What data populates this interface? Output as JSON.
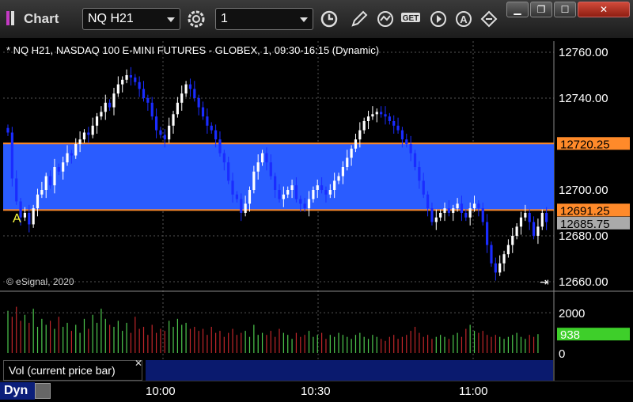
{
  "window": {
    "title": "Chart"
  },
  "toolbar": {
    "symbol": "NQ H21",
    "interval": "1",
    "icons": [
      "settings-gear-icon",
      "clock-icon",
      "pencil-icon",
      "study-icon",
      "get-icon",
      "play-icon",
      "alert-icon",
      "link-icon"
    ],
    "window_controls": [
      "minimize-icon",
      "restore-icon",
      "maximize-icon",
      "close-icon"
    ]
  },
  "colors": {
    "band": "#2a5cff",
    "band_border": "#ff8a2a",
    "up": "#ffffff",
    "down": "#1a2cff",
    "vol_up": "#4ec94e",
    "vol_down": "#c0262a",
    "vol_badge": "#3ecf2a"
  },
  "chart_data": {
    "type": "candlestick",
    "title": "* NQ H21, NASDAQ 100 E-MINI FUTURES - GLOBEX, 1, 09:30-16:15 (Dynamic)",
    "copyright": "© eSignal, 2020",
    "ylim": [
      12655,
      12765
    ],
    "y_ticks": [
      "12760.00",
      "12740.00",
      "12720.00",
      "12700.00",
      "12680.00",
      "12660.00"
    ],
    "x_ticks": [
      "10:00",
      "10:30",
      "11:00"
    ],
    "band": {
      "top": 12720.25,
      "bottom": 12691.25
    },
    "price_labels": {
      "band_top": "12720.25",
      "band_bottom": "12691.25",
      "last": "12685.75"
    },
    "marker": "A",
    "candles_close": [
      12725,
      12705,
      12695,
      12688,
      12690,
      12685,
      12692,
      12698,
      12700,
      12706,
      12702,
      12710,
      12708,
      12712,
      12716,
      12715,
      12720,
      12722,
      12725,
      12724,
      12728,
      12732,
      12734,
      12738,
      12736,
      12742,
      12746,
      12748,
      12750,
      12749,
      12747,
      12744,
      12740,
      12738,
      12732,
      12726,
      12724,
      12722,
      12728,
      12733,
      12738,
      12742,
      12746,
      12744,
      12740,
      12736,
      12732,
      12728,
      12726,
      12722,
      12716,
      12712,
      12704,
      12698,
      12696,
      12690,
      12694,
      12700,
      12708,
      12712,
      12716,
      12712,
      12706,
      12700,
      12696,
      12698,
      12700,
      12702,
      12696,
      12694,
      12692,
      12696,
      12700,
      12702,
      12700,
      12698,
      12700,
      12704,
      12706,
      12710,
      12714,
      12718,
      12722,
      12726,
      12730,
      12732,
      12733,
      12734,
      12733,
      12732,
      12730,
      12728,
      12726,
      12722,
      12720,
      12716,
      12710,
      12704,
      12698,
      12692,
      12686,
      12688,
      12690,
      12692,
      12690,
      12692,
      12694,
      12690,
      12688,
      12692,
      12694,
      12692,
      12686,
      12676,
      12668,
      12664,
      12668,
      12672,
      12676,
      12680,
      12684,
      12688,
      12690,
      12686,
      12680,
      12684,
      12690,
      12686
    ],
    "volume": {
      "ylim": [
        0,
        2600
      ],
      "y_ticks": [
        "2000",
        "0"
      ],
      "current": "938",
      "label": "Vol (current price bar)",
      "values": [
        2100,
        1800,
        2300,
        1600,
        1900,
        1500,
        2200,
        1300,
        1700,
        1400,
        1600,
        1200,
        1800,
        1300,
        1500,
        1100,
        1400,
        1000,
        1700,
        1200,
        1900,
        1500,
        2200,
        1700,
        1400,
        1300,
        1600,
        1100,
        1500,
        1000,
        1800,
        1200,
        1300,
        900,
        1400,
        1000,
        1200,
        1100,
        1600,
        1300,
        1700,
        1400,
        1500,
        1200,
        1300,
        1100,
        1200,
        900,
        1300,
        1000,
        1100,
        800,
        1000,
        1200,
        900,
        1000,
        1100,
        800,
        1400,
        900,
        1000,
        900,
        1100,
        800,
        1200,
        1000,
        900,
        700,
        1000,
        800,
        900,
        1100,
        800,
        900,
        1000,
        700,
        900,
        800,
        1000,
        900,
        800,
        700,
        900,
        1000,
        800,
        700,
        900,
        800,
        700,
        600,
        800,
        900,
        700,
        800,
        900,
        1100,
        1300,
        1000,
        800,
        900,
        700,
        800,
        900,
        800,
        700,
        900,
        1000,
        800,
        1200,
        1400,
        1100,
        1000,
        1100,
        900,
        800,
        900,
        800,
        700,
        800,
        900,
        1000,
        800,
        700,
        900,
        800,
        938
      ]
    }
  },
  "footer": {
    "dyn_label": "Dyn"
  }
}
